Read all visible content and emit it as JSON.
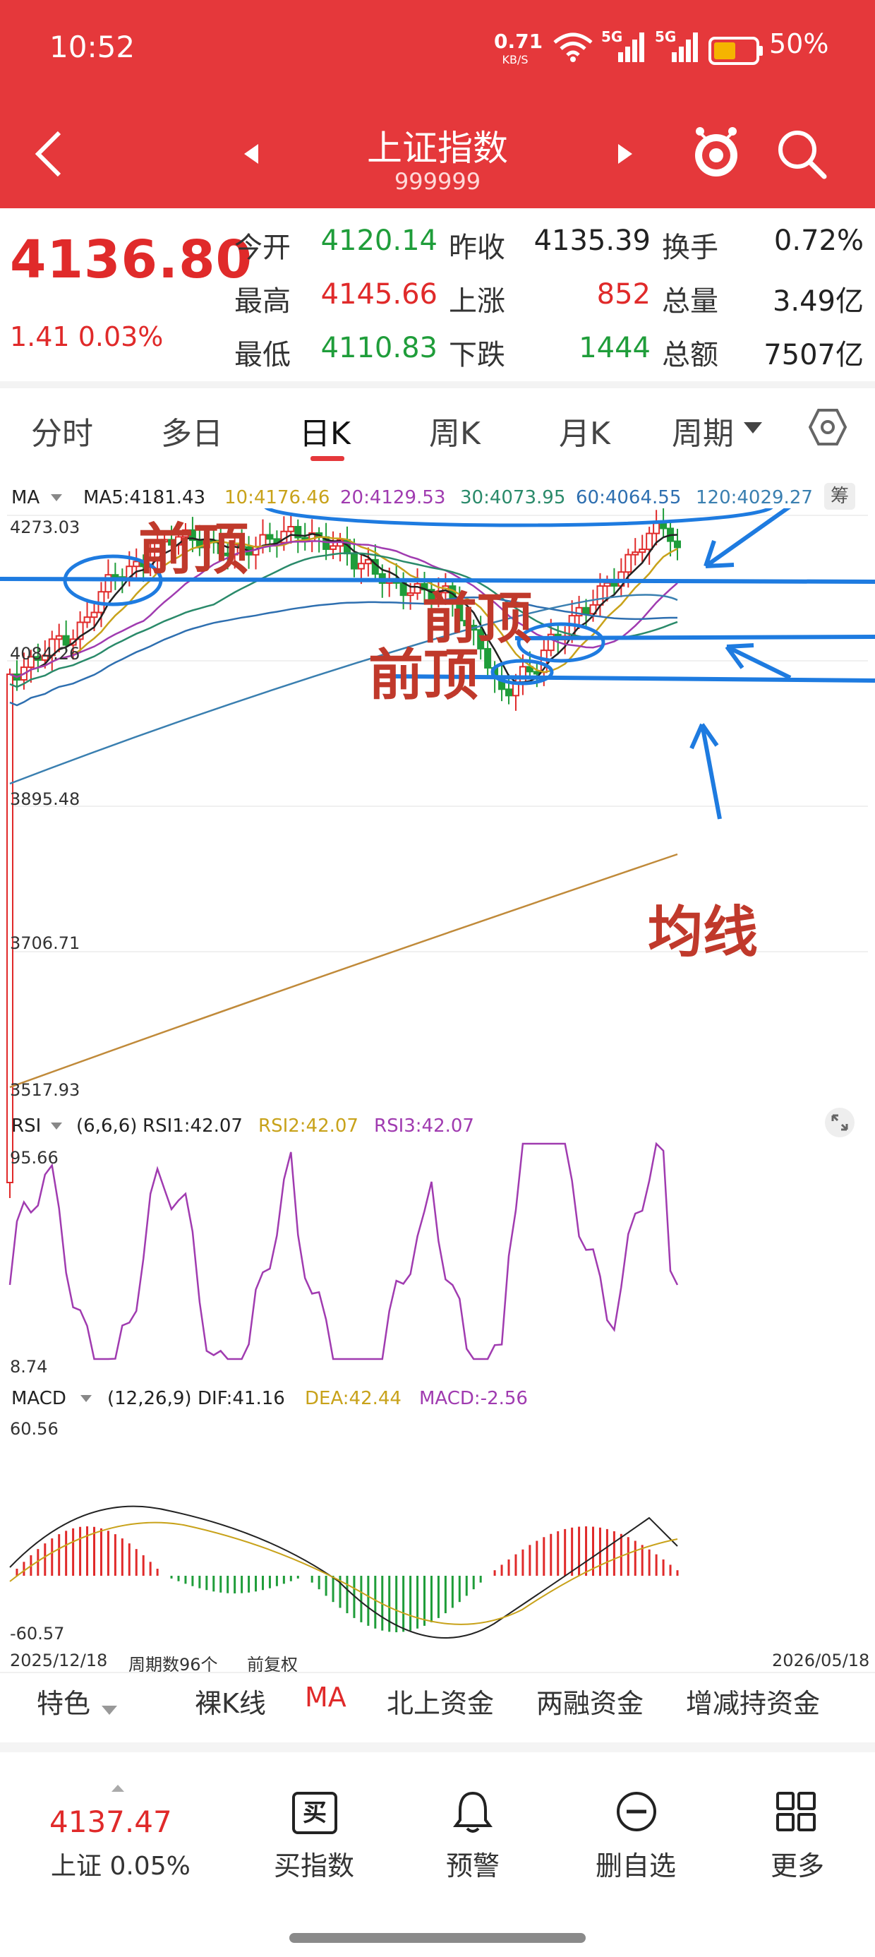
{
  "status_bar": {
    "time": "10:52",
    "net_speed": "0.71",
    "net_unit": "KB/S",
    "sig1": "5G",
    "sig2": "5G",
    "battery": "50%"
  },
  "header": {
    "title": "上证指数",
    "code": "999999"
  },
  "quote": {
    "price": "4136.80",
    "change": "1.41 0.03%",
    "rows": [
      [
        {
          "label": "今开",
          "value": "4120.14",
          "color": "green"
        },
        {
          "label": "昨收",
          "value": "4135.39",
          "color": "dark"
        },
        {
          "label": "换手",
          "value": "0.72%",
          "color": "dark"
        }
      ],
      [
        {
          "label": "最高",
          "value": "4145.66",
          "color": "red"
        },
        {
          "label": "上涨",
          "value": "852",
          "color": "red"
        },
        {
          "label": "总量",
          "value": "3.49亿",
          "color": "dark"
        }
      ],
      [
        {
          "label": "最低",
          "value": "4110.83",
          "color": "green"
        },
        {
          "label": "下跌",
          "value": "1444",
          "color": "green"
        },
        {
          "label": "总额",
          "value": "7507亿",
          "color": "dark"
        }
      ]
    ]
  },
  "tabs": [
    "分时",
    "多日",
    "日K",
    "周K",
    "月K",
    "周期"
  ],
  "active_tab": "日K",
  "ma_legend": {
    "label": "MA",
    "ma5": "MA5:4181.43",
    "ma10": "10:4176.46",
    "ma20": "20:4129.53",
    "ma30": "30:4073.95",
    "ma60": "60:4064.55",
    "ma120": "120:4029.27",
    "fq": "筹"
  },
  "price_axis": [
    "4273.03",
    "4084.26",
    "3895.48",
    "3706.71",
    "3517.93"
  ],
  "rsi_legend": {
    "label": "RSI",
    "params": "(6,6,6)",
    "rsi1": "RSI1:42.07",
    "rsi2": "RSI2:42.07",
    "rsi3": "RSI3:42.07"
  },
  "rsi_axis": [
    "95.66",
    "8.74"
  ],
  "macd_legend": {
    "label": "MACD",
    "params": "(12,26,9)",
    "dif": "DIF:41.16",
    "dea": "DEA:42.44",
    "macd": "MACD:-2.56"
  },
  "macd_axis": [
    "60.56",
    "-60.57"
  ],
  "footer_info": {
    "start": "2025/12/18",
    "period_count": "周期数96个",
    "adjust": "前复权",
    "end": "2026/05/18"
  },
  "annotations": {
    "top1": "前顶",
    "top2": "前顶",
    "top3": "前顶",
    "ma": "均线"
  },
  "sub_tabs": [
    "特色",
    "裸K线",
    "MA",
    "北上资金",
    "两融资金",
    "增减持资金"
  ],
  "bottom_nav": {
    "price": "4137.47",
    "index_label": "上证 0.05%",
    "buy": "买指数",
    "alert": "预警",
    "remove": "删自选",
    "more": "更多",
    "buy_icon_char": "买"
  },
  "colors": {
    "header": "#e5383b",
    "up": "#e02a2a",
    "down": "#1f9d3a",
    "ma5": "#222222",
    "ma10": "#c8a21a",
    "ma20": "#a03bb0",
    "ma30": "#2a8a6a",
    "ma60": "#2e6fb0",
    "ma120": "#3a7fb0",
    "long_ma": "#c08a3a",
    "annotation_blue": "#1e7be0"
  }
}
